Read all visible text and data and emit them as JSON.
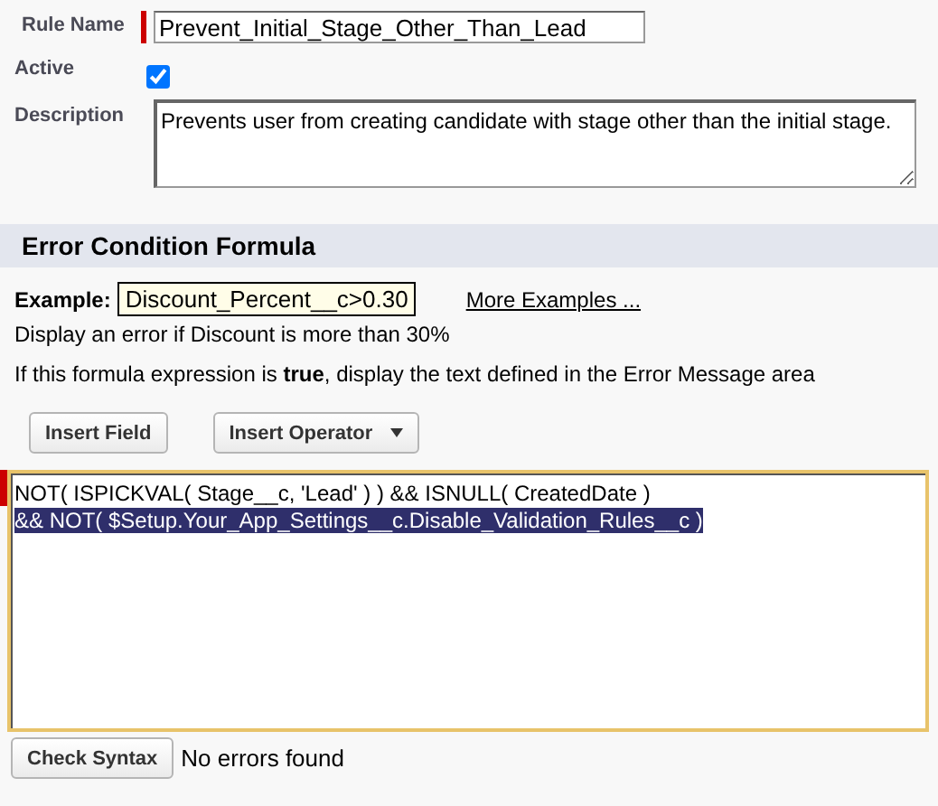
{
  "rule_name": {
    "label": "Rule Name",
    "value": "Prevent_Initial_Stage_Other_Than_Lead",
    "required": true
  },
  "active": {
    "label": "Active",
    "checked": true
  },
  "description": {
    "label": "Description",
    "value": "Prevents user from creating candidate with stage other than the initial stage."
  },
  "section": {
    "title": "Error Condition Formula"
  },
  "example": {
    "label": "Example:",
    "formula": "Discount_Percent__c>0.30",
    "link": "More Examples ...",
    "explanation": "Display an error if Discount is more than 30%"
  },
  "hint": "If this formula expression is **true**, display the text defined in the Error Message area",
  "insert_buttons": [
    {
      "label": "Insert Field",
      "kind": "plain"
    },
    {
      "label": "Insert Operator",
      "kind": "dropdown"
    }
  ],
  "formula": {
    "required": true,
    "lines": [
      {
        "text": "NOT( ISPICKVAL( Stage__c, 'Lead' ) ) && ISNULL( CreatedDate )",
        "selected": false
      },
      {
        "text": "&& NOT( $Setup.Your_App_Settings__c.Disable_Validation_Rules__c )",
        "selected": true
      }
    ]
  },
  "check_syntax": {
    "button": "Check Syntax",
    "result": "No errors found"
  }
}
